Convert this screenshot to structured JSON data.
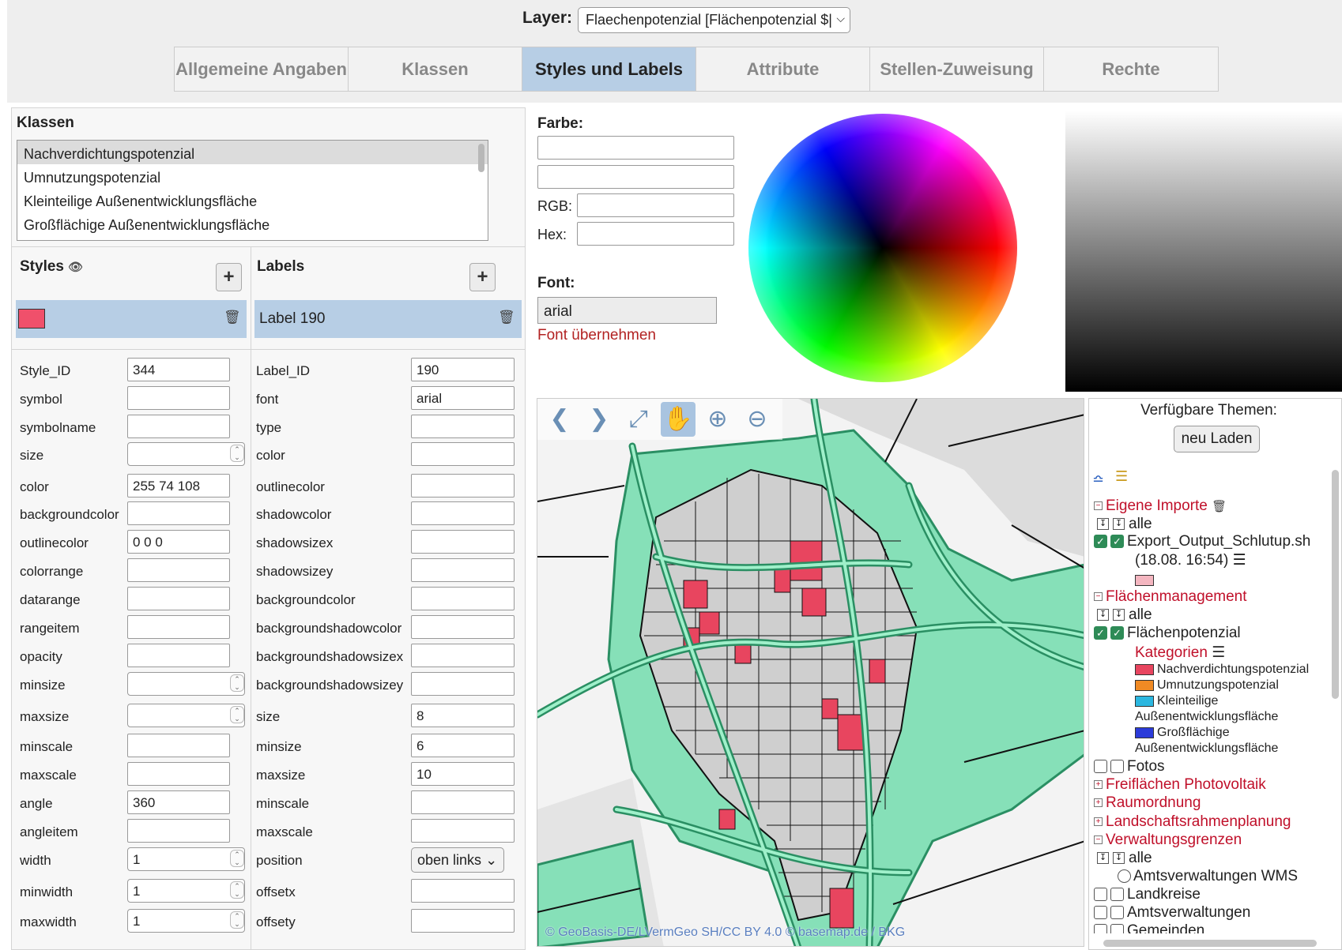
{
  "header": {
    "layer_label": "Layer:",
    "layer_value": "Flaechenpotenzial [Flächenpotenzial $|",
    "tabs": [
      "Allgemeine Angaben",
      "Klassen",
      "Styles und Labels",
      "Attribute",
      "Stellen-Zuweisung",
      "Rechte"
    ],
    "active_tab": "Styles und Labels"
  },
  "klassen": {
    "title": "Klassen",
    "items": [
      "Nachverdichtungspotenzial",
      "Umnutzungspotenzial",
      "Kleinteilige Außenentwicklungsfläche",
      "Großflächige Außenentwicklungsfläche"
    ],
    "selected": "Nachverdichtungspotenzial"
  },
  "styles": {
    "title": "Styles",
    "selected_color": "#f0506b",
    "fields": [
      {
        "label": "Style_ID",
        "value": "344"
      },
      {
        "label": "symbol",
        "value": ""
      },
      {
        "label": "symbolname",
        "value": ""
      },
      {
        "label": "size",
        "value": "",
        "spinner": true
      },
      {
        "label": "color",
        "value": "255 74 108"
      },
      {
        "label": "backgroundcolor",
        "value": ""
      },
      {
        "label": "outlinecolor",
        "value": "0 0 0"
      },
      {
        "label": "colorrange",
        "value": ""
      },
      {
        "label": "datarange",
        "value": ""
      },
      {
        "label": "rangeitem",
        "value": ""
      },
      {
        "label": "opacity",
        "value": ""
      },
      {
        "label": "minsize",
        "value": "",
        "spinner": true
      },
      {
        "label": "maxsize",
        "value": "",
        "spinner": true
      },
      {
        "label": "minscale",
        "value": ""
      },
      {
        "label": "maxscale",
        "value": ""
      },
      {
        "label": "angle",
        "value": "360"
      },
      {
        "label": "angleitem",
        "value": ""
      },
      {
        "label": "width",
        "value": "1",
        "spinner": true
      },
      {
        "label": "minwidth",
        "value": "1",
        "spinner": true
      },
      {
        "label": "maxwidth",
        "value": "1",
        "spinner": true
      }
    ]
  },
  "labels": {
    "title": "Labels",
    "selected_label": "Label 190",
    "fields": [
      {
        "label": "Label_ID",
        "value": "190"
      },
      {
        "label": "font",
        "value": "arial"
      },
      {
        "label": "type",
        "value": ""
      },
      {
        "label": "color",
        "value": ""
      },
      {
        "label": "outlinecolor",
        "value": ""
      },
      {
        "label": "shadowcolor",
        "value": ""
      },
      {
        "label": "shadowsizex",
        "value": ""
      },
      {
        "label": "shadowsizey",
        "value": ""
      },
      {
        "label": "backgroundcolor",
        "value": ""
      },
      {
        "label": "backgroundshadowcolor",
        "value": ""
      },
      {
        "label": "backgroundshadowsizex",
        "value": ""
      },
      {
        "label": "backgroundshadowsizey",
        "value": ""
      },
      {
        "label": "size",
        "value": "8"
      },
      {
        "label": "minsize",
        "value": "6"
      },
      {
        "label": "maxsize",
        "value": "10"
      },
      {
        "label": "minscale",
        "value": ""
      },
      {
        "label": "maxscale",
        "value": ""
      },
      {
        "label": "position",
        "value": "oben links",
        "select": true
      },
      {
        "label": "offsetx",
        "value": ""
      },
      {
        "label": "offsety",
        "value": ""
      }
    ]
  },
  "color_panel": {
    "farbe_label": "Farbe:",
    "rgb_label": "RGB:",
    "hex_label": "Hex:",
    "font_label": "Font:",
    "font_value": "arial",
    "font_apply_link": "Font übernehmen"
  },
  "map": {
    "attribution": "© GeoBasis-DE/LVermGeo SH/CC BY 4.0 © basemap.de / BKG",
    "tools": [
      "back-icon",
      "forward-icon",
      "zoom-extent-icon",
      "pan-hand-icon",
      "zoom-in-icon",
      "zoom-out-icon"
    ]
  },
  "themes": {
    "title": "Verfügbare Themen:",
    "reload_label": "neu Laden",
    "eigene_importe": "Eigene Importe",
    "alle_1": "alle",
    "export_layer": "Export_Output_Schlutup.sh",
    "export_time": "(18.08. 16:54)",
    "flaechenmanagement": "Flächenmanagement",
    "alle_2": "alle",
    "flaechenpotenzial": "Flächenpotenzial",
    "kategorien": "Kategorien",
    "legend": [
      {
        "label": "Nachverdichtungspotenzial",
        "color": "#e8455f"
      },
      {
        "label": "Umnutzungspotenzial",
        "color": "#f08a24"
      },
      {
        "label": "Kleinteilige",
        "color": "#2bb7e0"
      },
      {
        "label": "Großflächige",
        "color": "#2b3bd9"
      }
    ],
    "legend_cont": "Außenentwicklungsfläche",
    "fotos": "Fotos",
    "freiflaechen": "Freiflächen Photovoltaik",
    "raumordnung": "Raumordnung",
    "landschaft": "Landschaftsrahmenplanung",
    "verwaltung": "Verwaltungsgrenzen",
    "alle_3": "alle",
    "amtsverwaltungen_wms": "Amtsverwaltungen WMS",
    "landkreise": "Landkreise",
    "amtsverwaltungen": "Amtsverwaltungen",
    "gemeinden": "Gemeinden"
  }
}
